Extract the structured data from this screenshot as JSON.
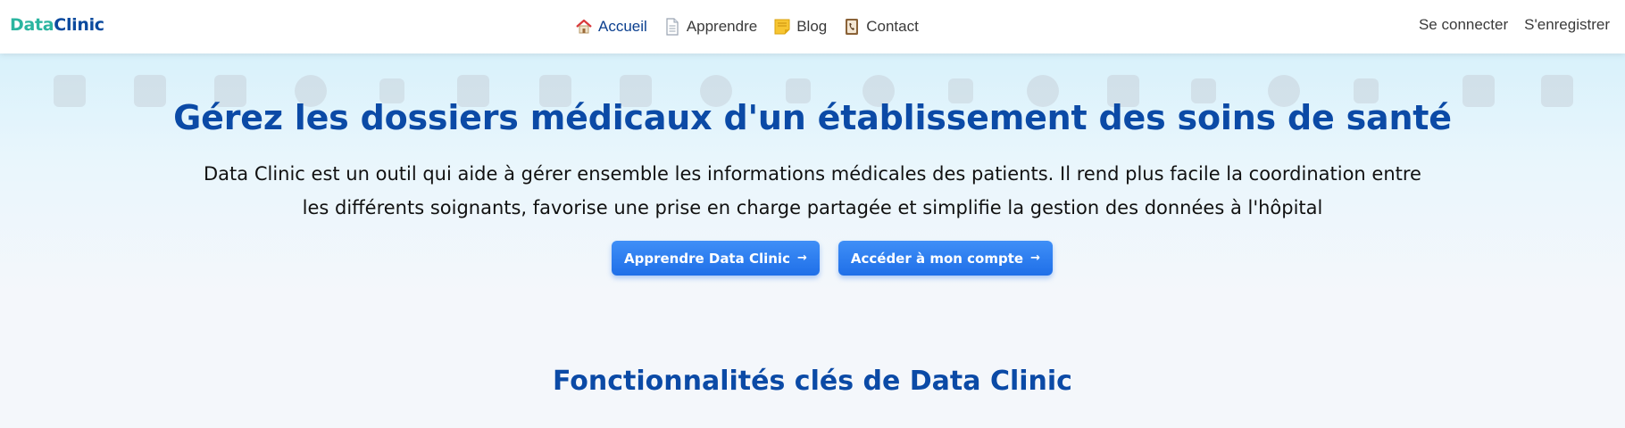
{
  "brand": {
    "part1": "Data",
    "part2": "Clinic"
  },
  "nav": {
    "items": [
      {
        "label": "Accueil",
        "icon": "house-icon",
        "active": true
      },
      {
        "label": "Apprendre",
        "icon": "document-icon",
        "active": false
      },
      {
        "label": "Blog",
        "icon": "note-icon",
        "active": false
      },
      {
        "label": "Contact",
        "icon": "phone-book-icon",
        "active": false
      }
    ],
    "login": "Se connecter",
    "register": "S'enregistrer"
  },
  "hero": {
    "title": "Gérez les dossiers médicaux d'un établissement des soins de santé",
    "description": "Data Clinic est un outil qui aide à gérer ensemble les informations médicales des patients. Il rend plus facile la coordination entre les différents soignants, favorise une prise en charge partagée et simplifie la gestion des données à l'hôpital",
    "buttons": [
      {
        "label": "Apprendre Data Clinic",
        "arrow": "→"
      },
      {
        "label": "Accéder à mon compte",
        "arrow": "→"
      }
    ]
  },
  "features": {
    "title": "Fonctionnalités clés de Data Clinic"
  },
  "colors": {
    "primary": "#0b4aa6",
    "accent_teal": "#2bb5a0",
    "button": "#2a7bf0",
    "hero_bg": "#d8f1fb"
  },
  "background_icons": [
    "hospital-bed-icon",
    "briefcase-icon",
    "certificate-icon",
    "doctors-icon",
    "checklist-icon",
    "monitor-chart-icon",
    "xray-icon",
    "hospital-icon",
    "database-icon",
    "clipboard-icon",
    "doctor-icon",
    "microscope-icon",
    "nurse-icon",
    "box-icon",
    "no-signal-icon",
    "patient-icon",
    "syringe-icon",
    "inbox-icon",
    "medical-cross-icon"
  ]
}
